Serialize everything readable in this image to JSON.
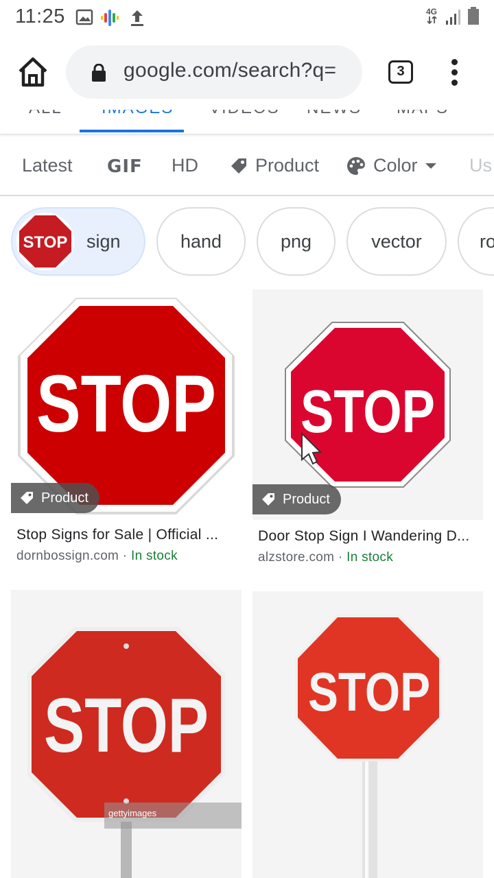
{
  "status_bar": {
    "time": "11:25",
    "network": "4G",
    "icons": [
      "image-icon",
      "podcast-icon",
      "upload-icon",
      "signal-icon",
      "battery-icon"
    ]
  },
  "browser": {
    "url": "google.com/search?q=",
    "tab_count": "3",
    "icons": [
      "home-icon",
      "lock-icon",
      "more-vert-icon"
    ]
  },
  "search_tabs": {
    "items": [
      "ALL",
      "IMAGES",
      "VIDEOS",
      "NEWS",
      "MAPS"
    ],
    "active": "IMAGES"
  },
  "tools": {
    "items": [
      {
        "label": "Latest"
      },
      {
        "label": "GIF"
      },
      {
        "label": "HD"
      },
      {
        "label": "Product",
        "icon": "tag-icon"
      },
      {
        "label": "Color",
        "icon": "palette-icon",
        "dropdown": true
      },
      {
        "label": "Us"
      }
    ]
  },
  "chips": {
    "items": [
      {
        "label": "sign",
        "thumb_text": "STOP",
        "selected": true
      },
      {
        "label": "hand"
      },
      {
        "label": "png"
      },
      {
        "label": "vector"
      },
      {
        "label": "ro"
      }
    ]
  },
  "results": [
    {
      "badge": "Product",
      "title": "Stop Signs for Sale | Official ...",
      "source": "dornbossign.com",
      "separator": "·",
      "stock": "In stock",
      "sign_text": "STOP"
    },
    {
      "badge": "Product",
      "title": "Door Stop Sign I Wandering D...",
      "source": "alzstore.com",
      "separator": "·",
      "stock": "In stock",
      "sign_text": "STOP"
    },
    {
      "sign_text": "STOP",
      "watermark": "gettyimages"
    },
    {
      "sign_text": "STOP"
    }
  ],
  "colors": {
    "accent": "#1a73e8",
    "stop_red": "#cc1f1a",
    "in_stock": "#188038"
  }
}
